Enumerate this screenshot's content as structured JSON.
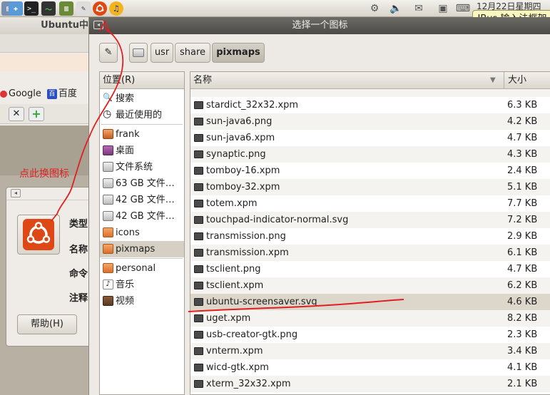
{
  "top_panel": {
    "clock": "12月22日星期四",
    "ibus_tooltip": "IBus 输入法框架",
    "icons": [
      "files-icon",
      "network-icon",
      "terminal-icon",
      "system-monitor-icon",
      "text-editor-icon",
      "editor-icon",
      "ubuntu-logo-icon",
      "audacity-icon"
    ],
    "tray_icons": [
      "accessibility-icon",
      "volume-icon",
      "mail-icon",
      "network-status-icon",
      "keyboard-icon"
    ]
  },
  "background_window": {
    "title": "Ubuntu中",
    "google_label": "Google",
    "baidu_label": "百度"
  },
  "launcher": {
    "labels": [
      "类型",
      "名称",
      "命令",
      "注释"
    ],
    "help_button": "帮助(H)"
  },
  "annotation": {
    "text": "点此换图标",
    "color": "#e02020"
  },
  "chooser": {
    "title": "选择一个图标",
    "pathbar": {
      "segments": [
        {
          "label": "usr",
          "active": false
        },
        {
          "label": "share",
          "active": false
        },
        {
          "label": "pixmaps",
          "active": true
        }
      ]
    },
    "places": {
      "header": "位置(R)",
      "items": [
        {
          "label": "搜索",
          "icon": "search-icon"
        },
        {
          "label": "最近使用的",
          "icon": "recent-icon"
        },
        {
          "label": "frank",
          "icon": "home-folder-icon"
        },
        {
          "label": "桌面",
          "icon": "desktop-icon"
        },
        {
          "label": "文件系统",
          "icon": "drive-icon"
        },
        {
          "label": "63 GB 文件…",
          "icon": "drive-icon"
        },
        {
          "label": "42 GB 文件…",
          "icon": "drive-icon"
        },
        {
          "label": "42 GB 文件…",
          "icon": "drive-icon"
        },
        {
          "label": "icons",
          "icon": "folder-icon"
        },
        {
          "label": "pixmaps",
          "icon": "folder-icon",
          "selected": true
        },
        {
          "label": "personal",
          "icon": "folder-icon"
        },
        {
          "label": "音乐",
          "icon": "music-icon"
        },
        {
          "label": "视频",
          "icon": "video-icon"
        }
      ]
    },
    "files": {
      "col_name": "名称",
      "col_size": "大小",
      "rows": [
        {
          "name": "stardict_32x32.xpm",
          "size": "6.3 KB"
        },
        {
          "name": "sun-java6.png",
          "size": "4.2 KB"
        },
        {
          "name": "sun-java6.xpm",
          "size": "4.7 KB"
        },
        {
          "name": "synaptic.png",
          "size": "4.3 KB"
        },
        {
          "name": "tomboy-16.xpm",
          "size": "2.4 KB"
        },
        {
          "name": "tomboy-32.xpm",
          "size": "5.1 KB"
        },
        {
          "name": "totem.xpm",
          "size": "7.7 KB"
        },
        {
          "name": "touchpad-indicator-normal.svg",
          "size": "7.2 KB"
        },
        {
          "name": "transmission.png",
          "size": "2.9 KB"
        },
        {
          "name": "transmission.xpm",
          "size": "6.1 KB"
        },
        {
          "name": "tsclient.png",
          "size": "4.7 KB"
        },
        {
          "name": "tsclient.xpm",
          "size": "6.2 KB"
        },
        {
          "name": "ubuntu-screensaver.svg",
          "size": "4.6 KB",
          "selected": true
        },
        {
          "name": "uget.xpm",
          "size": "8.2 KB"
        },
        {
          "name": "usb-creator-gtk.png",
          "size": "2.3 KB"
        },
        {
          "name": "vnterm.xpm",
          "size": "3.4 KB"
        },
        {
          "name": "wicd-gtk.xpm",
          "size": "4.1 KB"
        },
        {
          "name": "xterm_32x32.xpm",
          "size": "2.1 KB"
        }
      ]
    }
  }
}
